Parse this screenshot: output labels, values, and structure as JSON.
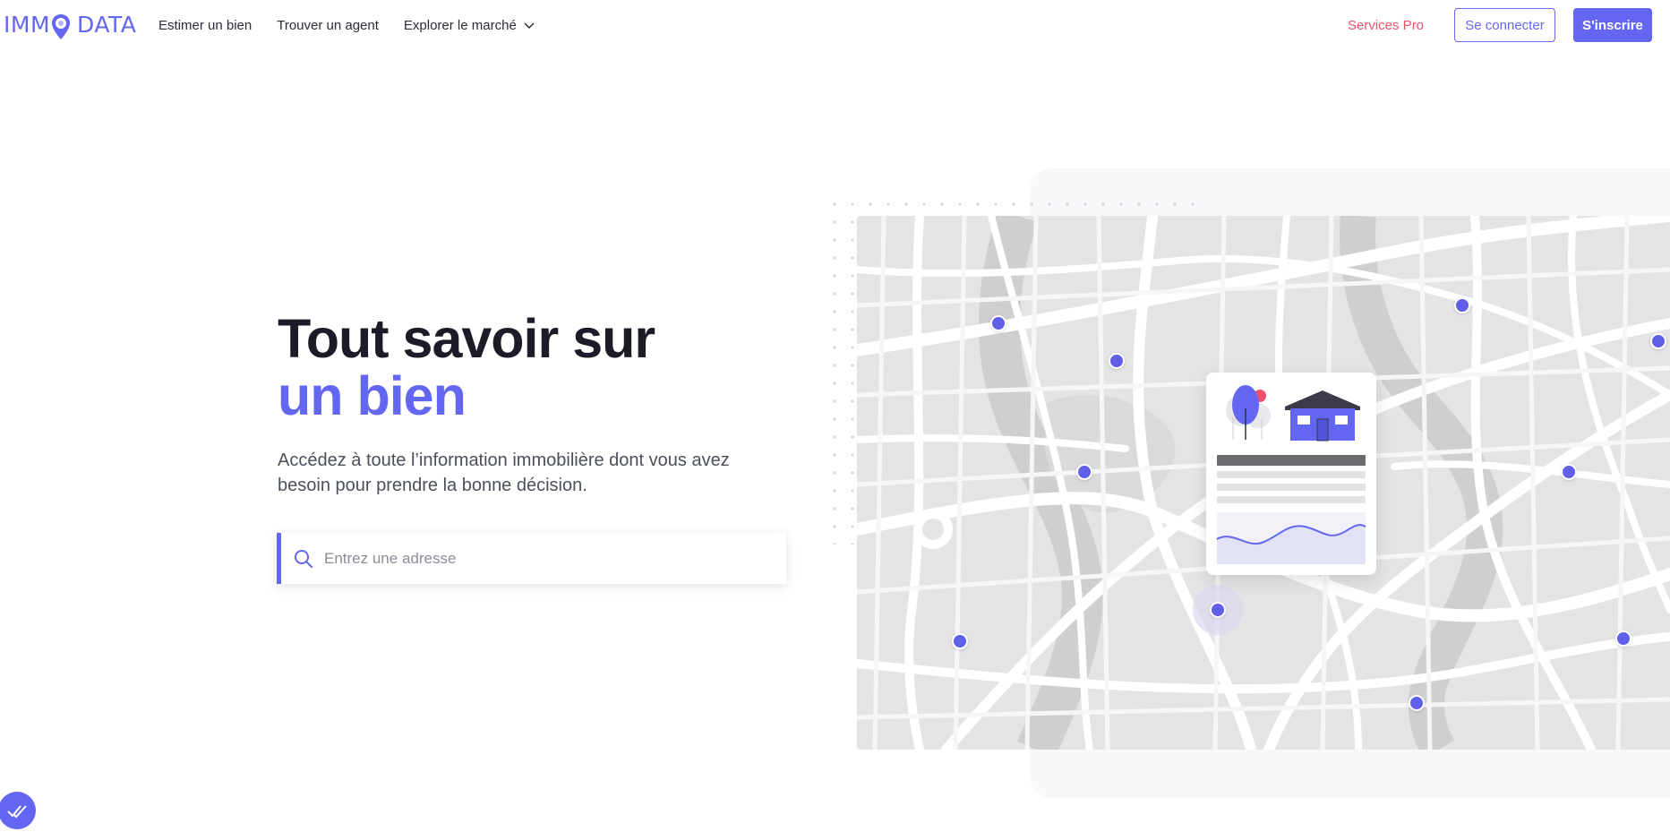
{
  "header": {
    "logo_left": "IMM",
    "logo_right": "DATA",
    "nav": [
      {
        "label": "Estimer un bien"
      },
      {
        "label": "Trouver un agent"
      },
      {
        "label": "Explorer le marché"
      }
    ],
    "services_label": "Services Pro",
    "login_label": "Se connecter",
    "signup_label": "S'inscrire"
  },
  "hero": {
    "title_line1": "Tout savoir sur",
    "title_line2": "un bien",
    "subtitle": "Accédez à toute l’information immobilière dont vous avez besoin pour prendre la bonne décision.",
    "search_placeholder": "Entrez une adresse",
    "search_value": ""
  },
  "colors": {
    "accent": "#6366f1",
    "services": "#f0506e",
    "text": "#1c1c28",
    "map_marker": "#5f5fe8"
  },
  "icons": {
    "search": "search-icon",
    "chevron": "chevron-down-icon",
    "logo_pin": "map-pin-icon",
    "fab": "check-double-icon"
  }
}
